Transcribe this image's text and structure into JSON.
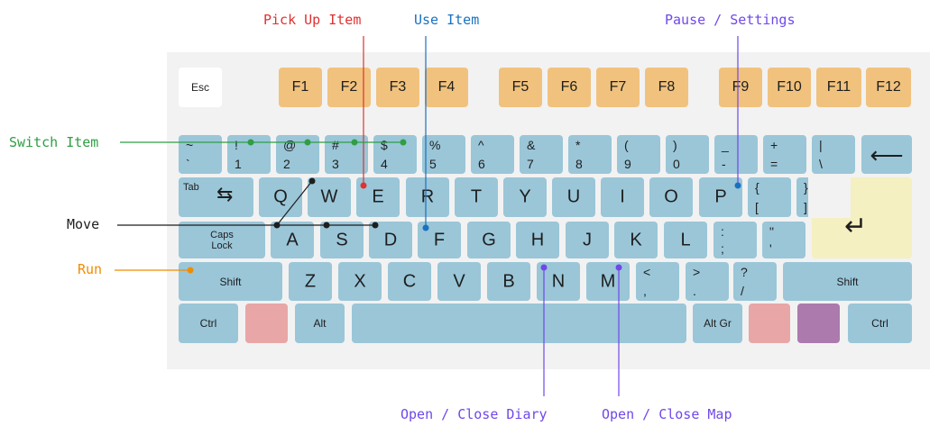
{
  "labels": {
    "pickup": "Pick Up Item",
    "use": "Use Item",
    "pause": "Pause / Settings",
    "switch": "Switch Item",
    "move": "Move",
    "run": "Run",
    "diary": "Open / Close Diary",
    "map": "Open / Close Map"
  },
  "colors": {
    "pickup": "#e03131",
    "use": "#1971c2",
    "pause": "#7048e8",
    "switch": "#2f9e44",
    "move": "#1e1e1e",
    "run": "#f08c00",
    "diary": "#7048e8",
    "map": "#7048e8",
    "key_blue": "#9ac6d8",
    "key_orange": "#f1c27d",
    "key_pink": "#e9a6a6",
    "key_purple": "#ac7aad",
    "key_cream": "#f4f0c1",
    "board": "#f2f2f2"
  },
  "keys": {
    "esc": "Esc",
    "f1": "F1",
    "f2": "F2",
    "f3": "F3",
    "f4": "F4",
    "f5": "F5",
    "f6": "F6",
    "f7": "F7",
    "f8": "F8",
    "f9": "F9",
    "f10": "F10",
    "f11": "F11",
    "f12": "F12",
    "backtick_top": "~",
    "backtick_bot": "`",
    "k1_top": "!",
    "k1_bot": "1",
    "k2_top": "@",
    "k2_bot": "2",
    "k3_top": "#",
    "k3_bot": "3",
    "k4_top": "$",
    "k4_bot": "4",
    "k5_top": "%",
    "k5_bot": "5",
    "k6_top": "^",
    "k6_bot": "6",
    "k7_top": "&",
    "k7_bot": "7",
    "k8_top": "*",
    "k8_bot": "8",
    "k9_top": "(",
    "k9_bot": "9",
    "k0_top": ")",
    "k0_bot": "0",
    "minus_top": "_",
    "minus_bot": "-",
    "equal_top": "+",
    "equal_bot": "=",
    "backslash_top": "|",
    "backslash_bot": "\\",
    "backspace": "⟵",
    "tab": "Tab",
    "tab_glyph": "⇆",
    "q": "Q",
    "w": "W",
    "e": "E",
    "r": "R",
    "t": "T",
    "y": "Y",
    "u": "U",
    "i": "I",
    "o": "O",
    "p": "P",
    "lbracket_top": "{",
    "lbracket_bot": "[",
    "rbracket_top": "}",
    "rbracket_bot": "]",
    "caps_line1": "Caps",
    "caps_line2": "Lock",
    "a": "A",
    "s": "S",
    "d": "D",
    "f": "F",
    "g": "G",
    "h": "H",
    "j": "J",
    "k": "K",
    "l": "L",
    "semicolon_top": ":",
    "semicolon_bot": ";",
    "quote_top": "\"",
    "quote_bot": "'",
    "enter": "↵",
    "shift_left": "Shift",
    "z": "Z",
    "x": "X",
    "c": "C",
    "v": "V",
    "b": "B",
    "n": "N",
    "m": "M",
    "comma_top": "<",
    "comma_bot": ",",
    "period_top": ">",
    "period_bot": ".",
    "slash_top": "?",
    "slash_bot": "/",
    "shift_right": "Shift",
    "ctrl_left": "Ctrl",
    "alt": "Alt",
    "altgr": "Alt Gr",
    "ctrl_right": "Ctrl"
  }
}
